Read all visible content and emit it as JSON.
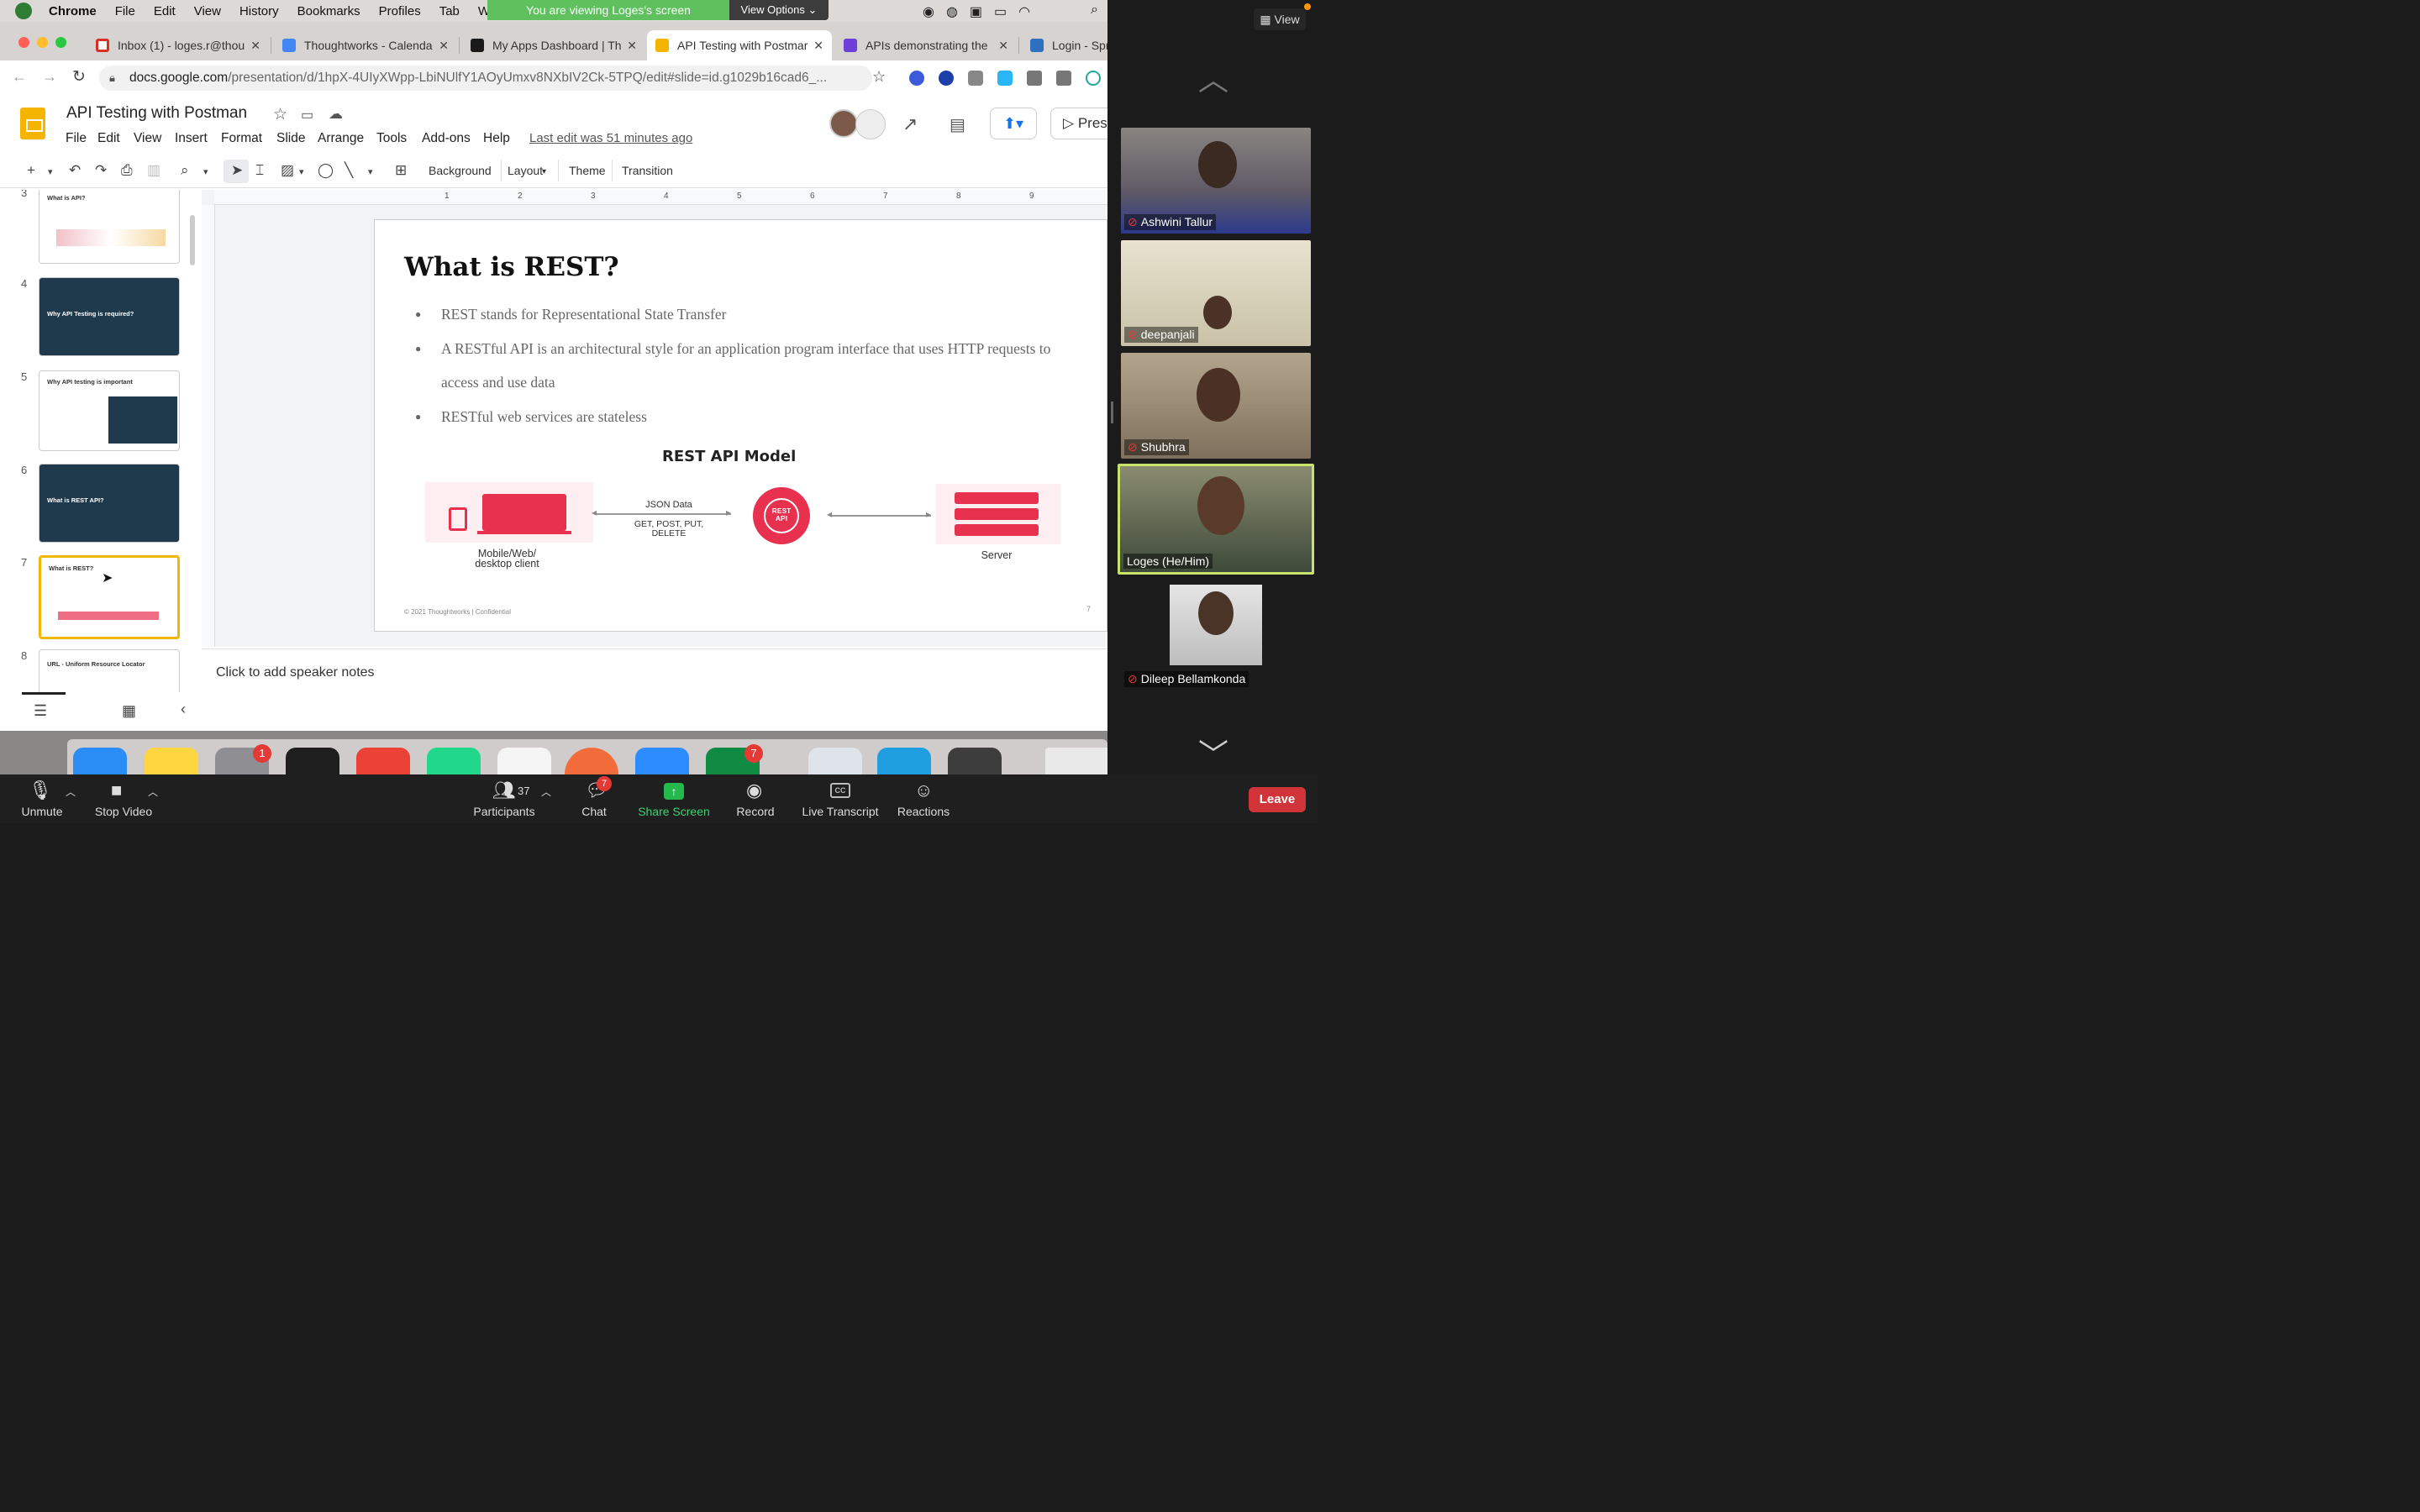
{
  "menubar": {
    "app": "Chrome",
    "items": [
      "File",
      "Edit",
      "View",
      "History",
      "Bookmarks",
      "Profiles",
      "Tab",
      "W"
    ]
  },
  "share_banner": {
    "text": "You are viewing Loges's screen",
    "view_options": "View Options"
  },
  "browser": {
    "tabs": [
      {
        "label": "Inbox (1) - loges.r@thou",
        "color": "#d93025"
      },
      {
        "label": "Thoughtworks - Calenda",
        "color": "#4285f4"
      },
      {
        "label": "My Apps Dashboard | Th",
        "color": "#1a1a1a"
      },
      {
        "label": "API Testing with Postmar",
        "color": "#f4b400"
      },
      {
        "label": "APIs demonstrating the",
        "color": "#6c3fd8"
      },
      {
        "label": "Login - Spr",
        "color": "#2f6fbf"
      }
    ],
    "url_host": "docs.google.com",
    "url_path": "/presentation/d/1hpX-4UIyXWpp-LbiNUlfY1AOyUmxv8NXbIV2Ck-5TPQ/edit#slide=id.g1029b16cad6_..."
  },
  "slides_app": {
    "title": "API Testing with Postman",
    "menu": [
      "File",
      "Edit",
      "View",
      "Insert",
      "Format",
      "Slide",
      "Arrange",
      "Tools",
      "Add-ons",
      "Help"
    ],
    "last_edit": "Last edit was 51 minutes ago",
    "present_label": "Pres",
    "toolbar": {
      "background": "Background",
      "layout": "Layout",
      "theme": "Theme",
      "transition": "Transition"
    },
    "ruler_marks": [
      "1",
      "2",
      "3",
      "4",
      "5",
      "6",
      "7",
      "8",
      "9"
    ],
    "filmstrip": [
      {
        "num": "3",
        "title": "What is API?",
        "dark": false
      },
      {
        "num": "4",
        "title": "Why API Testing is required?",
        "dark": true
      },
      {
        "num": "5",
        "title": "Why API testing is important",
        "dark": false
      },
      {
        "num": "6",
        "title": "What is REST API?",
        "dark": true
      },
      {
        "num": "7",
        "title": "What is REST?",
        "dark": false,
        "selected": true
      },
      {
        "num": "8",
        "title": "URL - Uniform Resource Locator",
        "dark": false
      }
    ],
    "slide": {
      "title": "What is REST?",
      "bullets": [
        "REST stands for Representational State Transfer",
        "A RESTful API is an architectural style for an application program interface that uses HTTP requests to access and use data",
        "RESTful web services are stateless"
      ],
      "model": {
        "title": "REST API Model",
        "client_label": "Mobile/Web/ desktop client",
        "json_label": "JSON Data",
        "methods_label": "GET, POST, PUT, DELETE",
        "gear_label": "REST API",
        "server_label": "Server",
        "accent": "#e8304f"
      },
      "footer": "© 2021 Thoughtworks  |  Confidential",
      "number": "7"
    },
    "notes_placeholder": "Click to add speaker notes"
  },
  "dock": {
    "badges": {
      "settings": "1",
      "chat_app": "7"
    }
  },
  "zoom": {
    "view_label": "View",
    "participants": [
      {
        "name": "Ashwini Tallur",
        "muted": true,
        "bg": "#6d6a75"
      },
      {
        "name": "deepanjali",
        "muted": true,
        "bg": "#d8d0b8"
      },
      {
        "name": "Shubhra",
        "muted": true,
        "bg": "#9c8f7a"
      },
      {
        "name": "Loges  (He/Him)",
        "muted": false,
        "bg": "#6a6e5a",
        "active": true
      },
      {
        "name": "Dileep Bellamkonda",
        "muted": true,
        "bg": "#2a2a2a"
      }
    ],
    "controls": {
      "unmute": "Unmute",
      "stop_video": "Stop Video",
      "participants": "Participants",
      "participants_count": "37",
      "chat": "Chat",
      "chat_badge": "7",
      "share_screen": "Share Screen",
      "record": "Record",
      "live_transcript": "Live Transcript",
      "reactions": "Reactions",
      "leave": "Leave"
    }
  }
}
